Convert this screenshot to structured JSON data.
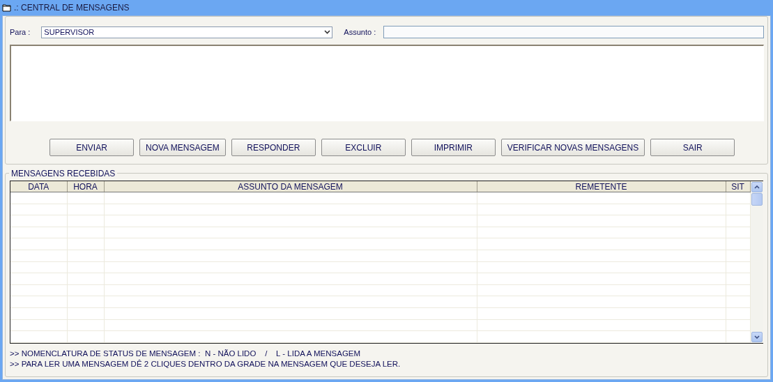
{
  "window": {
    "title": ".: CENTRAL DE MENSAGENS"
  },
  "compose": {
    "to_label": "Para :",
    "to_value": "SUPERVISOR",
    "subject_label": "Assunto :"
  },
  "buttons": [
    "ENVIAR",
    "NOVA MENSAGEM",
    "RESPONDER",
    "EXCLUIR",
    "IMPRIMIR",
    "VERIFICAR NOVAS MENSAGENS",
    "SAIR"
  ],
  "received": {
    "title": "MENSAGENS RECEBIDAS",
    "columns": [
      "DATA",
      "HORA",
      "ASSUNTO DA MENSAGEM",
      "REMETENTE",
      "SIT"
    ]
  },
  "notes": [
    ">> NOMENCLATURA DE STATUS DE MENSAGEM :  N - NÃO LIDO    /    L - LIDA A MENSAGEM",
    ">> PARA LER UMA MENSAGEM DÊ 2 CLIQUES DENTRO DA GRADE NA MENSAGEM QUE DESEJA LER."
  ]
}
